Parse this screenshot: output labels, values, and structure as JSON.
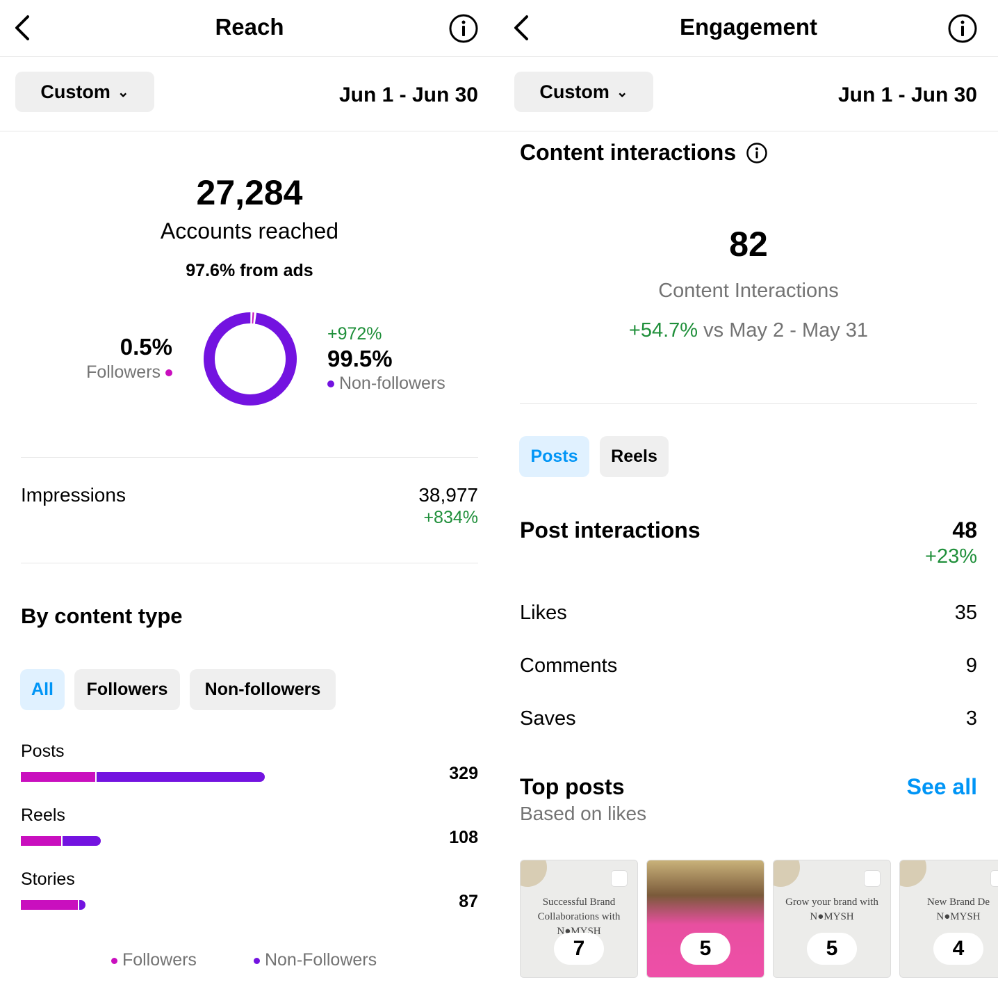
{
  "reach": {
    "title": "Reach",
    "range_button": "Custom",
    "date_range": "Jun 1 - Jun 30",
    "accounts_reached": "27,284",
    "accounts_reached_label": "Accounts reached",
    "from_ads": "97.6% from ads",
    "followers_pct": "0.5%",
    "followers_label": "Followers",
    "followers_share": 0.5,
    "nonfollowers_change": "+972%",
    "nonfollowers_pct": "99.5%",
    "nonfollowers_label": "Non-followers",
    "nonfollowers_share": 99.5,
    "impressions_label": "Impressions",
    "impressions_value": "38,977",
    "impressions_change": "+834%",
    "by_content_title": "By content type",
    "filters": [
      "All",
      "Followers",
      "Non-followers"
    ],
    "content": [
      {
        "label": "Posts",
        "value": "329",
        "total": 329,
        "followers_fraction": 0.31
      },
      {
        "label": "Reels",
        "value": "108",
        "total": 108,
        "followers_fraction": 0.52
      },
      {
        "label": "Stories",
        "value": "87",
        "total": 87,
        "followers_fraction": 0.9
      }
    ],
    "legend": [
      "Followers",
      "Non-Followers"
    ]
  },
  "engagement": {
    "title": "Engagement",
    "range_button": "Custom",
    "date_range": "Jun 1 - Jun 30",
    "section_title": "Content interactions",
    "total": "82",
    "total_label": "Content Interactions",
    "change": "+54.7%",
    "compare": "vs May 2 - May 31",
    "tabs": [
      "Posts",
      "Reels"
    ],
    "post_interactions_label": "Post interactions",
    "post_interactions_value": "48",
    "post_interactions_change": "+23%",
    "rows": [
      {
        "label": "Likes",
        "value": "35"
      },
      {
        "label": "Comments",
        "value": "9"
      },
      {
        "label": "Saves",
        "value": "3"
      }
    ],
    "top_posts_title": "Top posts",
    "top_posts_subtitle": "Based on likes",
    "see_all": "See all",
    "top_posts": [
      {
        "text1": "Successful Brand",
        "text2": "Collaborations with",
        "text3": "N●MYSH",
        "likes": "7"
      },
      {
        "text1": "",
        "text2": "",
        "text3": "",
        "likes": "5"
      },
      {
        "text1": "Grow your brand with",
        "text2": "N●MYSH",
        "text3": "",
        "likes": "5"
      },
      {
        "text1": "New Brand De",
        "text2": "N●MYSH",
        "text3": "",
        "likes": "4"
      }
    ]
  },
  "colors": {
    "followers": "#c90fbe",
    "nonfollowers": "#7313e0",
    "accent": "#0095f6",
    "positive": "#1f8f3a"
  }
}
